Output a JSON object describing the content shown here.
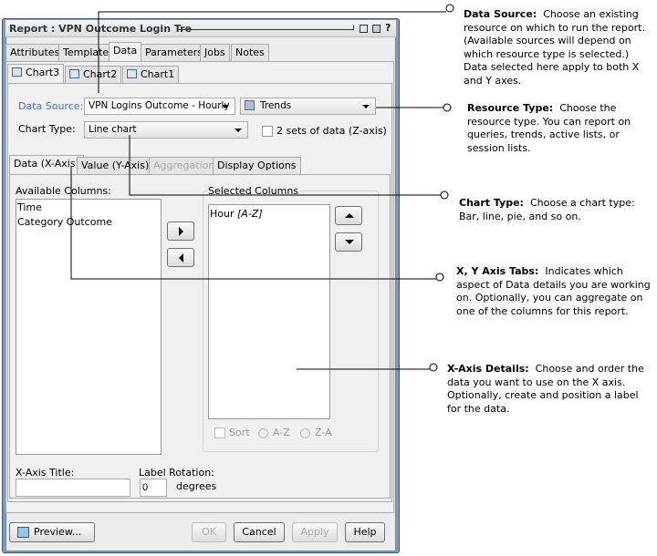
{
  "dialog": {
    "title": "Report : VPN Outcome Login Tre",
    "tabs": [
      "Attributes",
      "Template",
      "Data",
      "Parameters",
      "Jobs",
      "Notes"
    ],
    "chart_tabs": [
      "Chart3",
      "Chart2",
      "Chart1"
    ],
    "data_source_label": "Data Source:",
    "data_source_value": "VPN Logins Outcome - Hourly",
    "resource_type_value": "Trends",
    "chart_type_label": "Chart Type:",
    "chart_type_value": "Line chart",
    "z_axis_label": "2 sets of data (Z-axis)",
    "axis_tabs": [
      "Data (X-Axis)",
      "Value (Y-Axis)",
      "Aggregation",
      "Display Options"
    ],
    "available_label": "Available Columns:",
    "available": [
      "Time",
      "Category Outcome"
    ],
    "selected_label": "Selected Columns",
    "selected": [
      {
        "name": "Hour",
        "sort": "[A-Z]"
      }
    ],
    "sort_label": "Sort",
    "az_label": "A-Z",
    "za_label": "Z-A",
    "x_title_label": "X-Axis Title:",
    "x_title_value": "",
    "rotation_label": "Label Rotation:",
    "rotation_value": "0",
    "degrees_label": "degrees",
    "buttons": {
      "preview": "Preview...",
      "ok": "OK",
      "cancel": "Cancel",
      "apply": "Apply",
      "help": "Help"
    }
  },
  "callouts": [
    {
      "title": "Data Source:",
      "text": "Choose an existing resource on which to run the report. (Available sources will depend on which resource type is selected.) Data selected here apply to both X and Y axes."
    },
    {
      "title": "Resource Type:",
      "text": "Choose the resource type. You can report on queries, trends, active lists, or session lists."
    },
    {
      "title": "Chart Type:",
      "text": "Choose a chart type: Bar, line, pie, and so on."
    },
    {
      "title": "X, Y Axis Tabs:",
      "text": "Indicates which aspect of Data details you are working on. Optionally, you can aggregate on one of the columns for this report."
    },
    {
      "title": "X-Axis Details:",
      "text": "Choose and order the data you want to use on the X axis. Optionally, create and position a label for the data."
    }
  ],
  "colors": {
    "accent_label": "#4a6fd0",
    "frame": "#7f9db9"
  }
}
